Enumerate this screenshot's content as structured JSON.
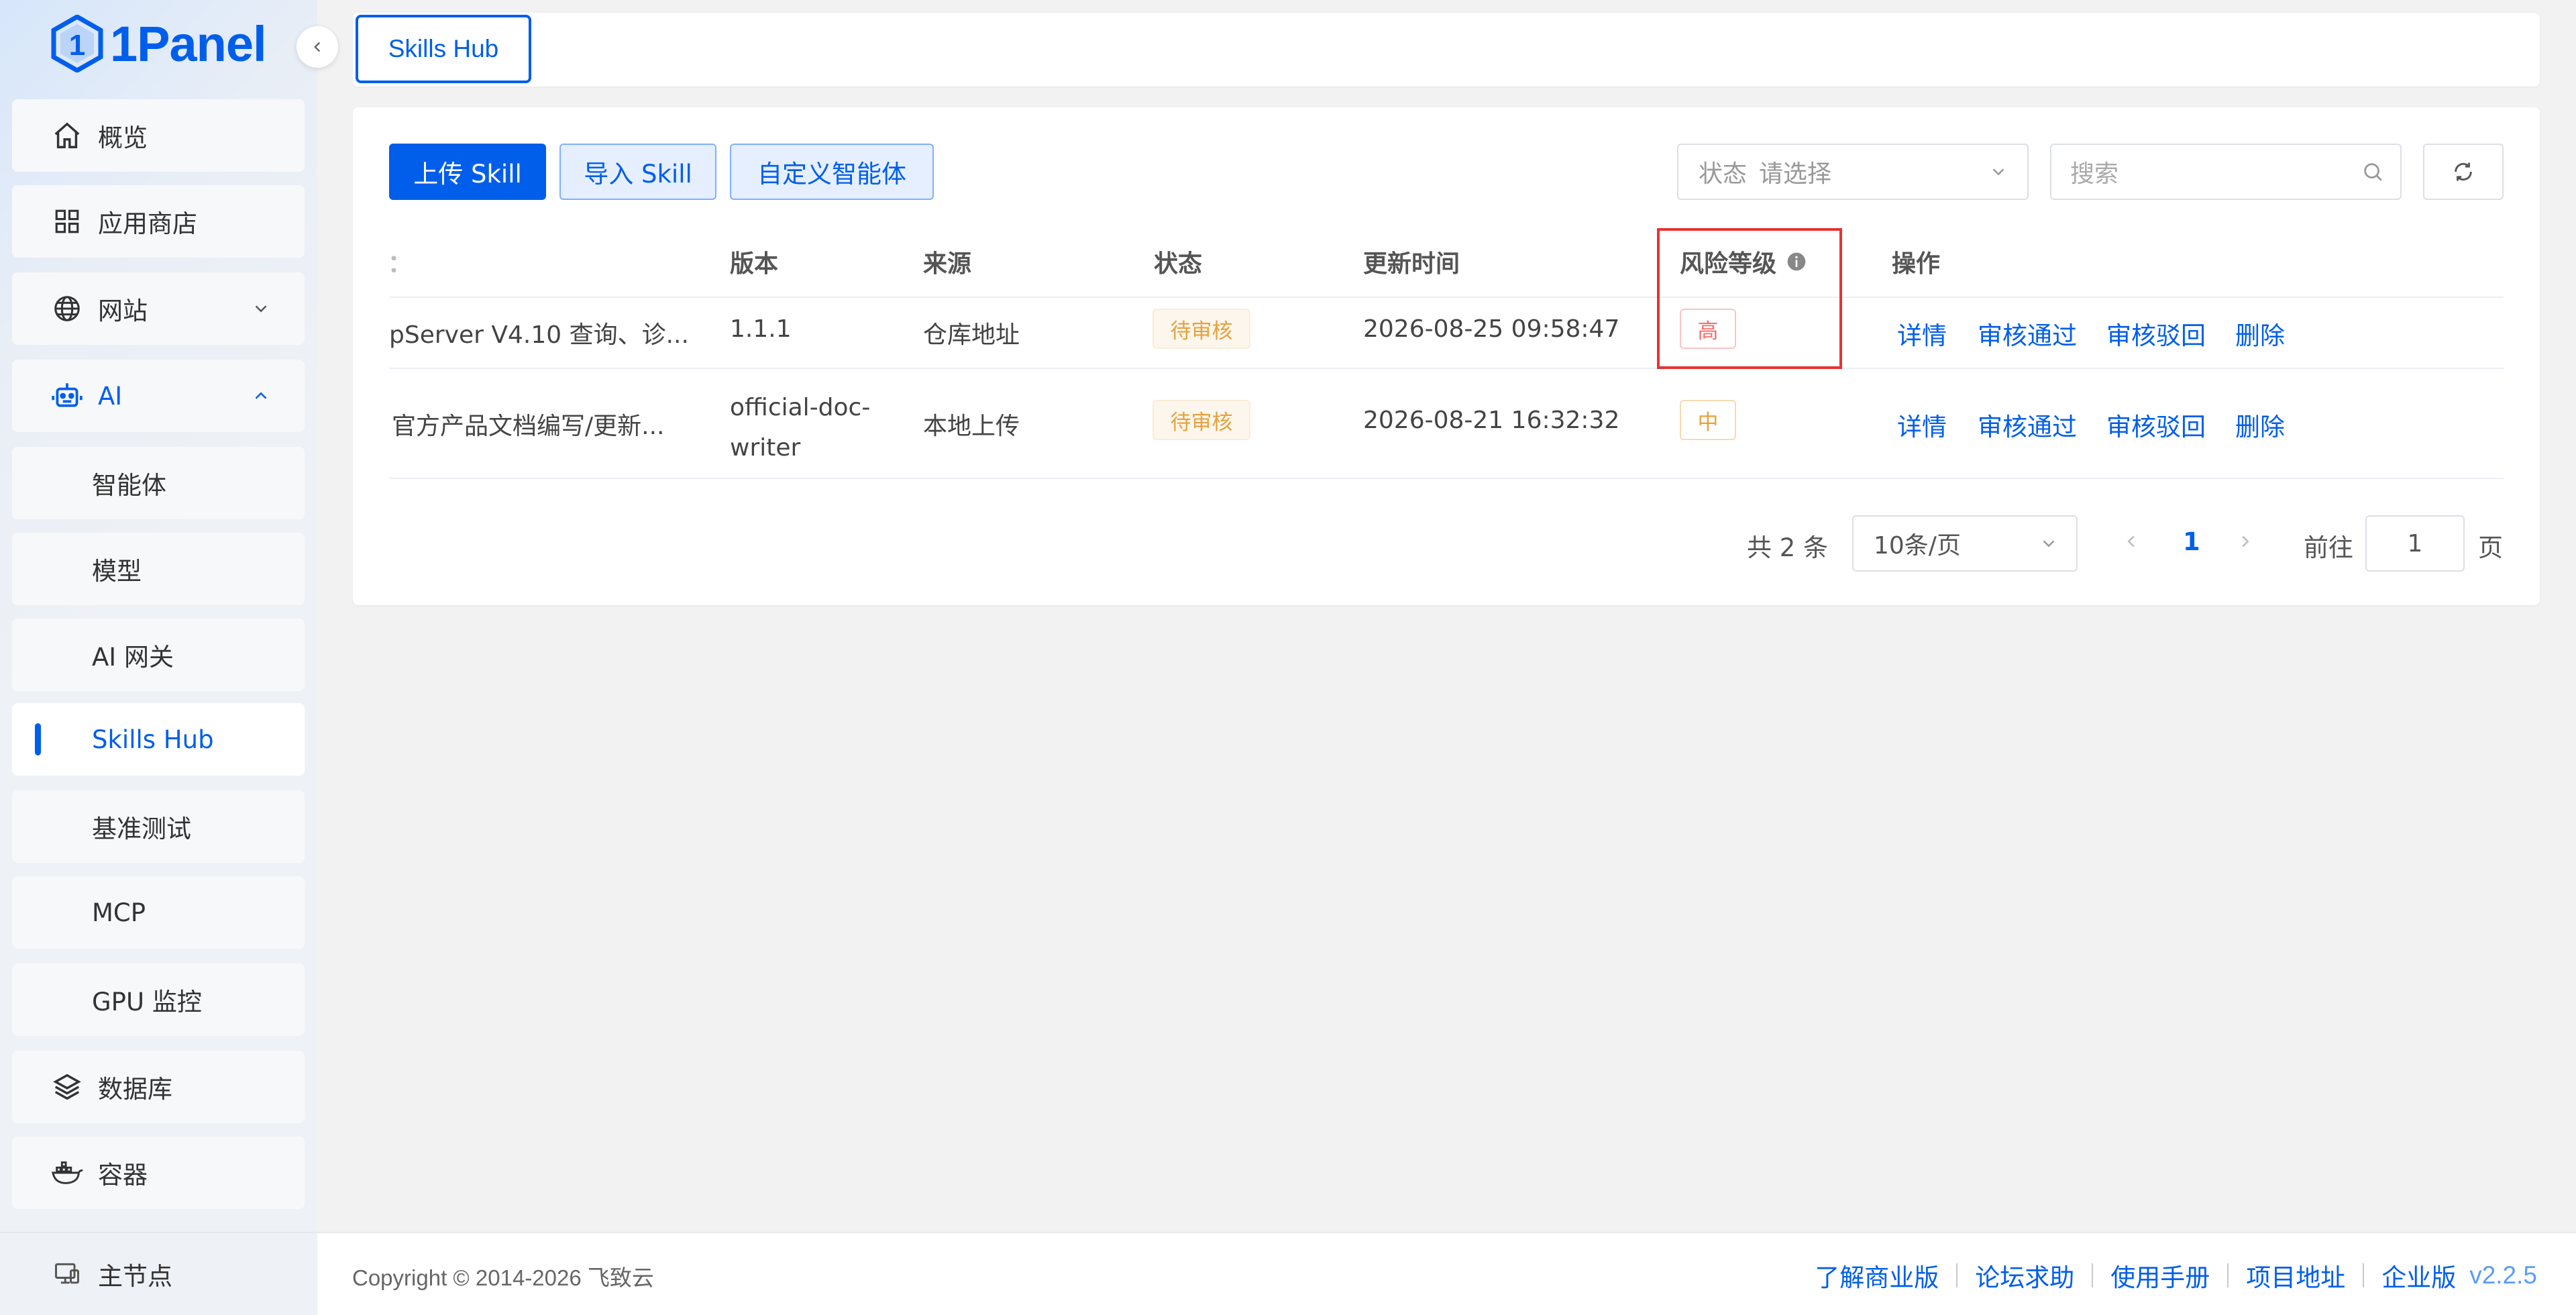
{
  "app": {
    "logo_text": "1Panel",
    "colors": {
      "primary": "#005eeb",
      "danger": "#f56c6c",
      "warning": "#e6a23c"
    }
  },
  "sidebar": {
    "items": [
      {
        "label": "概览",
        "icon": "home-icon"
      },
      {
        "label": "应用商店",
        "icon": "grid-icon"
      },
      {
        "label": "网站",
        "icon": "globe-icon"
      },
      {
        "label": "AI",
        "icon": "robot-icon"
      },
      {
        "label": "智能体"
      },
      {
        "label": "模型"
      },
      {
        "label": "AI 网关"
      },
      {
        "label": "Skills Hub"
      },
      {
        "label": "基准测试"
      },
      {
        "label": "MCP"
      },
      {
        "label": "GPU 监控"
      },
      {
        "label": "数据库",
        "icon": "layers-icon"
      },
      {
        "label": "容器",
        "icon": "docker-icon"
      }
    ],
    "bottom_node": "主节点"
  },
  "topbar": {
    "tab_label": "Skills Hub"
  },
  "toolbar": {
    "upload_label": "上传 Skill",
    "import_label": "导入 Skill",
    "custom_agent_label": "自定义智能体",
    "status_select_prefix": "状态",
    "status_select_placeholder": "请选择",
    "search_placeholder": "搜索"
  },
  "table": {
    "headers": {
      "name": "：",
      "version": "版本",
      "source": "来源",
      "status": "状态",
      "updated": "更新时间",
      "risk": "风险等级",
      "actions": "操作"
    },
    "rows": [
      {
        "name": "pServer V4.10 查询、诊...",
        "version": "1.1.1",
        "version_line2": "",
        "source": "仓库地址",
        "status": "待审核",
        "updated": "2026-08-25 09:58:47",
        "risk": "高"
      },
      {
        "name": "官方产品文档编写/更新...",
        "version": "official-doc-",
        "version_line2": "writer",
        "source": "本地上传",
        "status": "待审核",
        "updated": "2026-08-21 16:32:32",
        "risk": "中"
      }
    ],
    "action_labels": {
      "detail": "详情",
      "approve": "审核通过",
      "reject": "审核驳回",
      "delete": "删除"
    }
  },
  "pagination": {
    "total_text": "共 2 条",
    "page_size": "10条/页",
    "current_page": "1",
    "goto_label": "前往",
    "goto_value": "1",
    "page_suffix": "页"
  },
  "footer": {
    "copyright": "Copyright © 2014-2026 飞致云",
    "links": [
      "了解商业版",
      "论坛求助",
      "使用手册",
      "项目地址",
      "企业版"
    ],
    "version": "v2.2.5"
  }
}
